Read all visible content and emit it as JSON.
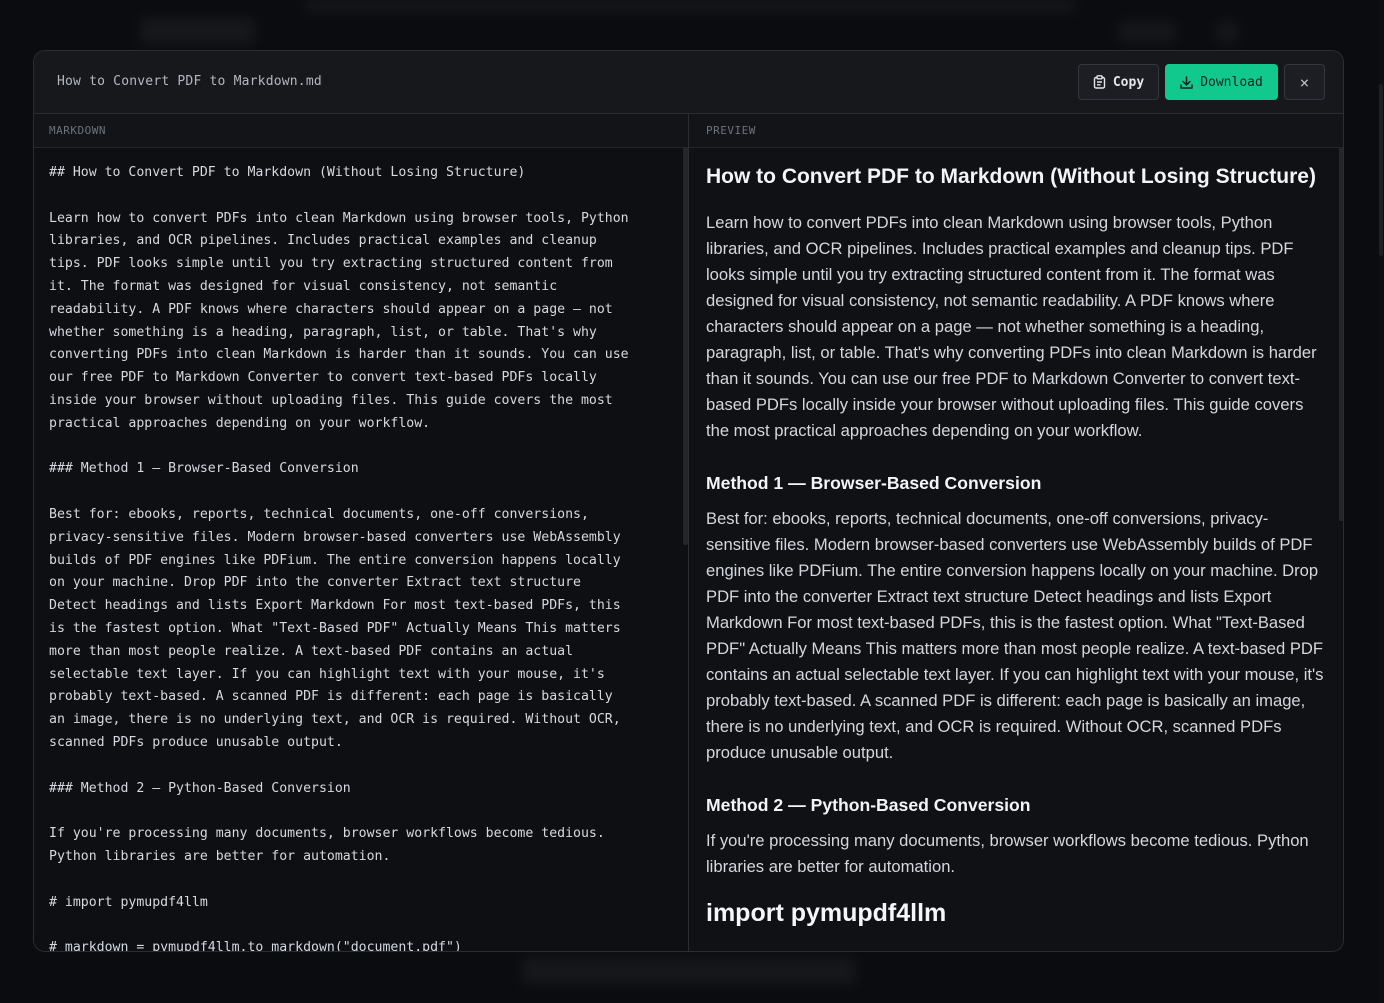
{
  "modal": {
    "file_name": "How to Convert PDF to Markdown.md",
    "copy_label": "Copy",
    "download_label": "Download",
    "close_icon": "×",
    "colors": {
      "accent": "#11c98c",
      "background": "#0f1115",
      "border": "#2a2d33"
    }
  },
  "markdown_pane": {
    "label": "MARKDOWN",
    "content": "## How to Convert PDF to Markdown (Without Losing Structure)\n\nLearn how to convert PDFs into clean Markdown using browser tools, Python\nlibraries, and OCR pipelines. Includes practical examples and cleanup\ntips. PDF looks simple until you try extracting structured content from\nit. The format was designed for visual consistency, not semantic\nreadability. A PDF knows where characters should appear on a page — not\nwhether something is a heading, paragraph, list, or table. That's why\nconverting PDFs into clean Markdown is harder than it sounds. You can use\nour free PDF to Markdown Converter to convert text-based PDFs locally\ninside your browser without uploading files. This guide covers the most\npractical approaches depending on your workflow.\n\n### Method 1 — Browser-Based Conversion\n\nBest for: ebooks, reports, technical documents, one-off conversions,\nprivacy-sensitive files. Modern browser-based converters use WebAssembly\nbuilds of PDF engines like PDFium. The entire conversion happens locally\non your machine. Drop PDF into the converter Extract text structure\nDetect headings and lists Export Markdown For most text-based PDFs, this\nis the fastest option. What \"Text-Based PDF\" Actually Means This matters\nmore than most people realize. A text-based PDF contains an actual\nselectable text layer. If you can highlight text with your mouse, it's\nprobably text-based. A scanned PDF is different: each page is basically\nan image, there is no underlying text, and OCR is required. Without OCR,\nscanned PDFs produce unusable output.\n\n### Method 2 — Python-Based Conversion\n\nIf you're processing many documents, browser workflows become tedious.\nPython libraries are better for automation.\n\n# import pymupdf4llm\n\n# markdown = pymupdf4llm.to_markdown(\"document.pdf\")"
  },
  "preview_pane": {
    "label": "PREVIEW",
    "title": "How to Convert PDF to Markdown (Without Losing Structure)",
    "intro": "Learn how to convert PDFs into clean Markdown using browser tools, Python libraries, and OCR pipelines. Includes practical examples and cleanup tips. PDF looks simple until you try extracting structured content from it. The format was designed for visual consistency, not semantic readability. A PDF knows where characters should appear on a page — not whether something is a heading, paragraph, list, or table. That's why converting PDFs into clean Markdown is harder than it sounds. You can use our free PDF to Markdown Converter to convert text-based PDFs locally inside your browser without uploading files. This guide covers the most practical approaches depending on your workflow.",
    "method1_heading": "Method 1 — Browser-Based Conversion",
    "method1_body": "Best for: ebooks, reports, technical documents, one-off conversions, privacy-sensitive files. Modern browser-based converters use WebAssembly builds of PDF engines like PDFium. The entire conversion happens locally on your machine. Drop PDF into the converter Extract text structure Detect headings and lists Export Markdown For most text-based PDFs, this is the fastest option. What \"Text-Based PDF\" Actually Means This matters more than most people realize. A text-based PDF contains an actual selectable text layer. If you can highlight text with your mouse, it's probably text-based. A scanned PDF is different: each page is basically an image, there is no underlying text, and OCR is required. Without OCR, scanned PDFs produce unusable output.",
    "method2_heading": "Method 2 — Python-Based Conversion",
    "method2_body": "If you're processing many documents, browser workflows become tedious. Python libraries are better for automation.",
    "import_heading": "import pymupdf4llm"
  }
}
